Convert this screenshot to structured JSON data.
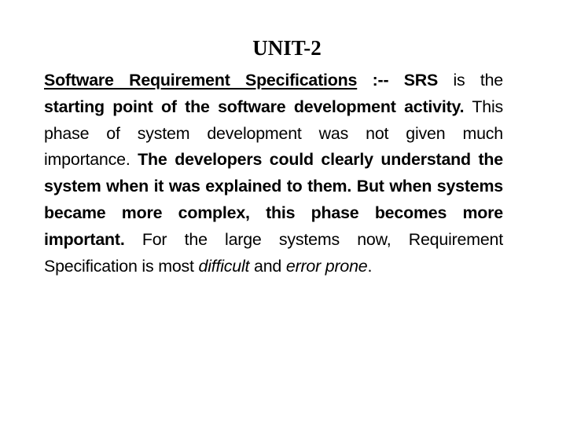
{
  "slide": {
    "title": "UNIT-2",
    "paragraph": {
      "runs": [
        {
          "text": "Software Requirement Specifications",
          "bold": true,
          "italic": false,
          "underline": true
        },
        {
          "text": " :-- SRS",
          "bold": true,
          "italic": false,
          "underline": false
        },
        {
          "text": " is the ",
          "bold": false,
          "italic": false,
          "underline": false
        },
        {
          "text": "starting point of the software development activity.",
          "bold": true,
          "italic": false,
          "underline": false
        },
        {
          "text": " This phase of system development was not given much importance. ",
          "bold": false,
          "italic": false,
          "underline": false
        },
        {
          "text": "The developers could clearly understand the system when it was explained to them. But when systems became more complex, this phase becomes more important.",
          "bold": true,
          "italic": false,
          "underline": false
        },
        {
          "text": " For the large systems now, Requirement Specification is most ",
          "bold": false,
          "italic": false,
          "underline": false
        },
        {
          "text": "difficult",
          "bold": false,
          "italic": true,
          "underline": false
        },
        {
          "text": " and ",
          "bold": false,
          "italic": false,
          "underline": false
        },
        {
          "text": "error prone",
          "bold": false,
          "italic": true,
          "underline": false
        },
        {
          "text": ".",
          "bold": false,
          "italic": false,
          "underline": false
        }
      ]
    }
  }
}
